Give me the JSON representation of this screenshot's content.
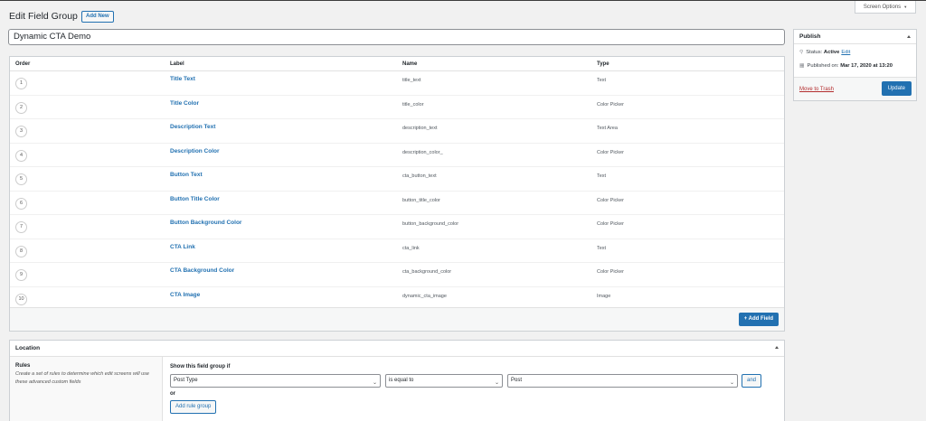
{
  "screen_options": {
    "label": "Screen Options"
  },
  "header": {
    "title": "Edit Field Group",
    "add_new": "Add New"
  },
  "field_group_title": "Dynamic CTA Demo",
  "fields_table": {
    "columns": {
      "order": "Order",
      "label": "Label",
      "name": "Name",
      "type": "Type"
    },
    "rows": [
      {
        "order": "1",
        "label": "Title Text",
        "name": "title_text",
        "type": "Text"
      },
      {
        "order": "2",
        "label": "Title Color",
        "name": "title_color",
        "type": "Color Picker"
      },
      {
        "order": "3",
        "label": "Description Text",
        "name": "description_text",
        "type": "Text Area"
      },
      {
        "order": "4",
        "label": "Description Color",
        "name": "description_color_",
        "type": "Color Picker"
      },
      {
        "order": "5",
        "label": "Button Text",
        "name": "cta_button_text",
        "type": "Text"
      },
      {
        "order": "6",
        "label": "Button Title Color",
        "name": "button_title_color",
        "type": "Color Picker"
      },
      {
        "order": "7",
        "label": "Button Background Color",
        "name": "button_background_color",
        "type": "Color Picker"
      },
      {
        "order": "8",
        "label": "CTA Link",
        "name": "cta_link",
        "type": "Text"
      },
      {
        "order": "9",
        "label": "CTA Background Color",
        "name": "cta_background_color",
        "type": "Color Picker"
      },
      {
        "order": "10",
        "label": "CTA Image",
        "name": "dynamic_cta_image",
        "type": "Image"
      }
    ],
    "add_field": "+ Add Field"
  },
  "location": {
    "title": "Location",
    "rules_title": "Rules",
    "rules_description": "Create a set of rules to determine which edit screens will use these advanced custom fields",
    "show_if": "Show this field group if",
    "param": "Post Type",
    "operator": "is equal to",
    "value": "Post",
    "and_label": "and",
    "or_label": "or",
    "add_rule_group": "Add rule group"
  },
  "publish": {
    "title": "Publish",
    "status_label": "Status:",
    "status_value": "Active",
    "edit_link": "Edit",
    "published_label": "Published on:",
    "published_value": "Mar 17, 2020 at 13:20",
    "trash": "Move to Trash",
    "update": "Update"
  },
  "colors": {
    "primary": "#2271b1",
    "danger": "#b32d2e",
    "background": "#f1f1f1"
  }
}
